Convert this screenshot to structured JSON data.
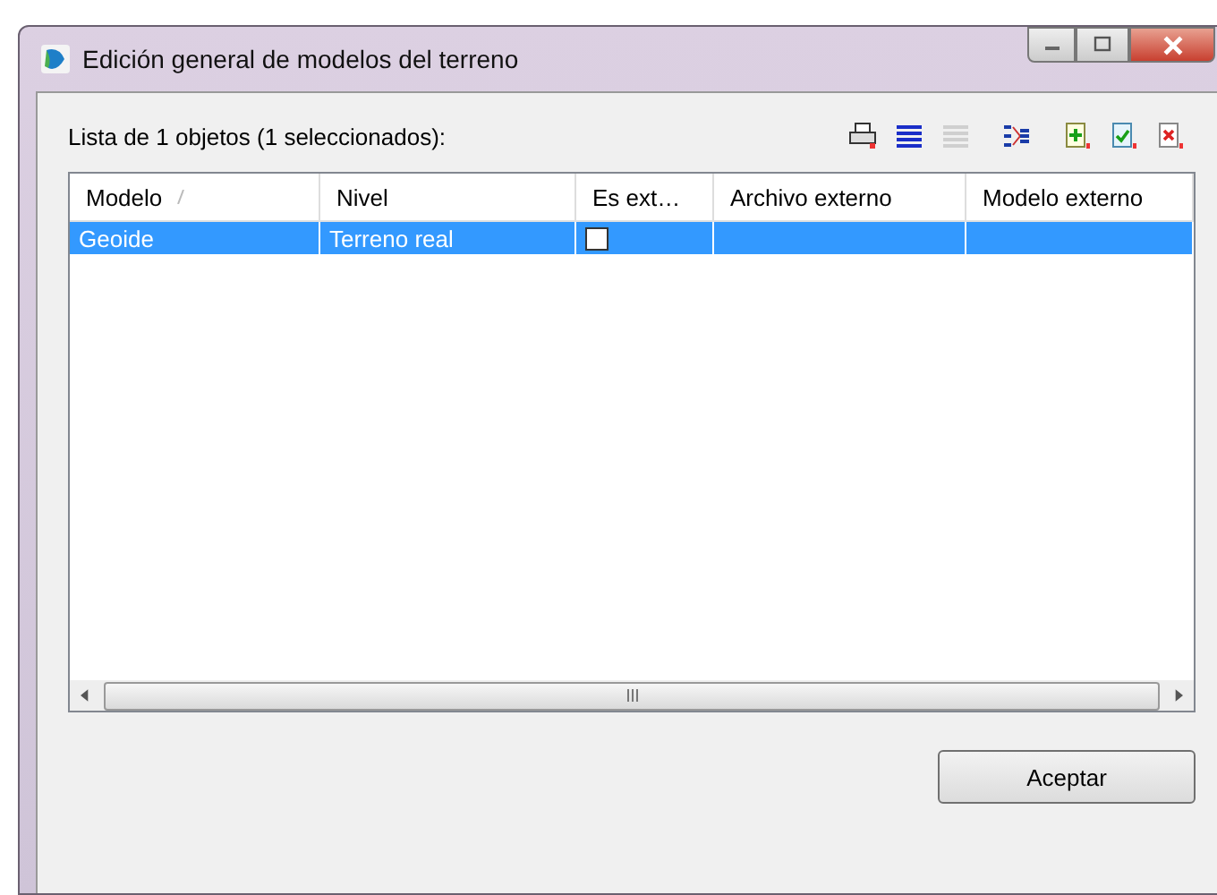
{
  "window": {
    "title": "Edición general de modelos del terreno"
  },
  "list_label": "Lista de 1 objetos (1 seleccionados):",
  "toolbar": [
    {
      "kind": "print"
    },
    {
      "kind": "lines",
      "disabled": false
    },
    {
      "kind": "lines",
      "disabled": true
    },
    {
      "kind": "tree"
    },
    {
      "kind": "add"
    },
    {
      "kind": "check"
    },
    {
      "kind": "delete"
    }
  ],
  "table": {
    "columns": [
      {
        "label": "Modelo",
        "sorted": true
      },
      {
        "label": "Nivel",
        "sorted": false
      },
      {
        "label": "Es ext…",
        "sorted": false
      },
      {
        "label": "Archivo externo",
        "sorted": false
      },
      {
        "label": "Modelo externo",
        "sorted": false
      }
    ],
    "rows": [
      {
        "selected": true,
        "cells": [
          {
            "kind": "text",
            "text": "Geoide"
          },
          {
            "kind": "text",
            "text": "Terreno real"
          },
          {
            "kind": "checkbox",
            "checked": false
          },
          {
            "kind": "text",
            "text": ""
          },
          {
            "kind": "text",
            "text": ""
          }
        ]
      }
    ]
  },
  "buttons": [
    {
      "label": "Aceptar"
    }
  ]
}
